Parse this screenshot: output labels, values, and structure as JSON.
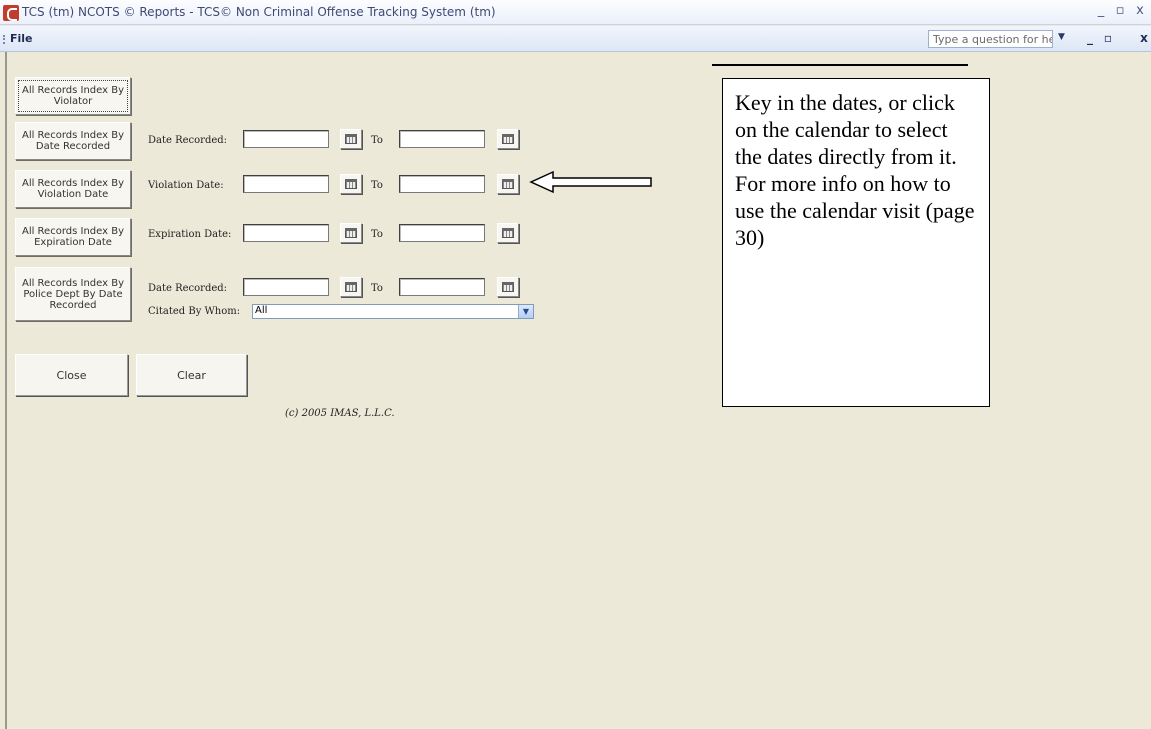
{
  "window": {
    "title": "TCS (tm) NCOTS © Reports - TCS© Non Criminal Offense Tracking System (tm)",
    "controls": [
      "_",
      "▫",
      "x"
    ]
  },
  "menubar": {
    "file": "File",
    "help_placeholder": "Type a question for help",
    "mdi_controls": [
      "_",
      "▫",
      "x"
    ]
  },
  "buttons": {
    "by_violator": "All Records Index By Violator",
    "by_date_recorded": "All Records Index By Date Recorded",
    "by_violation_date": "All Records Index By Violation Date",
    "by_expiration_date": "All Records Index By Expiration Date",
    "by_police_dept": "All Records Index By Police Dept By Date Recorded",
    "close": "Close",
    "clear": "Clear"
  },
  "rows": {
    "date_recorded": {
      "label": "Date Recorded:",
      "to": "To",
      "from_value": "",
      "to_value": ""
    },
    "violation_date": {
      "label": "Violation Date:",
      "to": "To",
      "from_value": "",
      "to_value": ""
    },
    "expiration_date": {
      "label": "Expiration Date:",
      "to": "To",
      "from_value": "",
      "to_value": ""
    },
    "police_date_recorded": {
      "label": "Date Recorded:",
      "to": "To",
      "from_value": "",
      "to_value": ""
    },
    "citated_by": {
      "label": "Citated By Whom:",
      "value": "All"
    }
  },
  "copyright": "(c) 2005 IMAS, L.L.C.",
  "callout": {
    "text": "Key in the dates, or click on the calendar to select the dates directly from it. For more info on how to use the calendar visit (page 30)"
  }
}
